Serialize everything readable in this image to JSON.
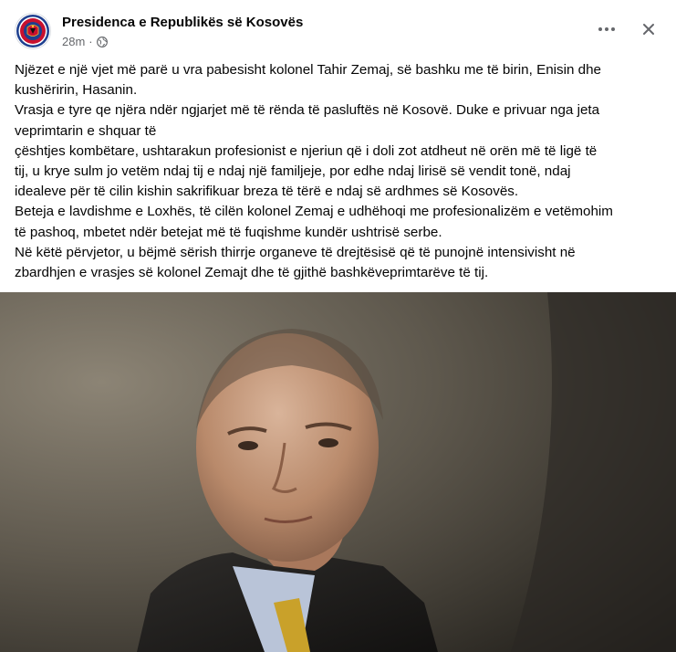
{
  "post": {
    "page_name": "Presidenca e Republikës së Kosovës",
    "timestamp": "28m",
    "separator": "·",
    "privacy_icon": "globe-icon",
    "more_icon": "more-horizontal-icon",
    "close_icon": "close-icon",
    "lines": [
      "Njëzet e një vjet më parë u vra pabesisht kolonel Tahir Zemaj, së bashku me të birin, Enisin dhe",
      "kushëririn, Hasanin.",
      "Vrasja e tyre qe njëra ndër ngjarjet më të rënda të pasluftës në Kosovë. Duke e privuar nga jeta",
      "veprimtarin e shquar të",
      "çështjes kombëtare, ushtarakun profesionist e njeriun që i doli zot atdheut në orën më të ligë të",
      "tij, u krye sulm jo vetëm ndaj tij e ndaj një familjeje, por edhe ndaj lirisë së vendit tonë, ndaj",
      "idealeve për të cilin kishin sakrifikuar breza të tërë e ndaj së ardhmes së Kosovës.",
      "Beteja e lavdishme e Loxhës, të cilën kolonel Zemaj e udhëhoqi me profesionalizëm e vetëmohim",
      "të pashoq, mbetet ndër betejat më të fuqishme kundër ushtrisë serbe.",
      "Në këtë përvjetor, u bëjmë sërish thirrje organeve të drejtësisë që të punojnë intensivisht në",
      "zbardhjen e vrasjes së kolonel Zemajt dhe të gjithë bashkëveprimtarëve të tij."
    ],
    "colors": {
      "text": "#050505",
      "secondary": "#65676b",
      "seal_red": "#c8102e",
      "seal_blue": "#1d3f8f"
    }
  }
}
